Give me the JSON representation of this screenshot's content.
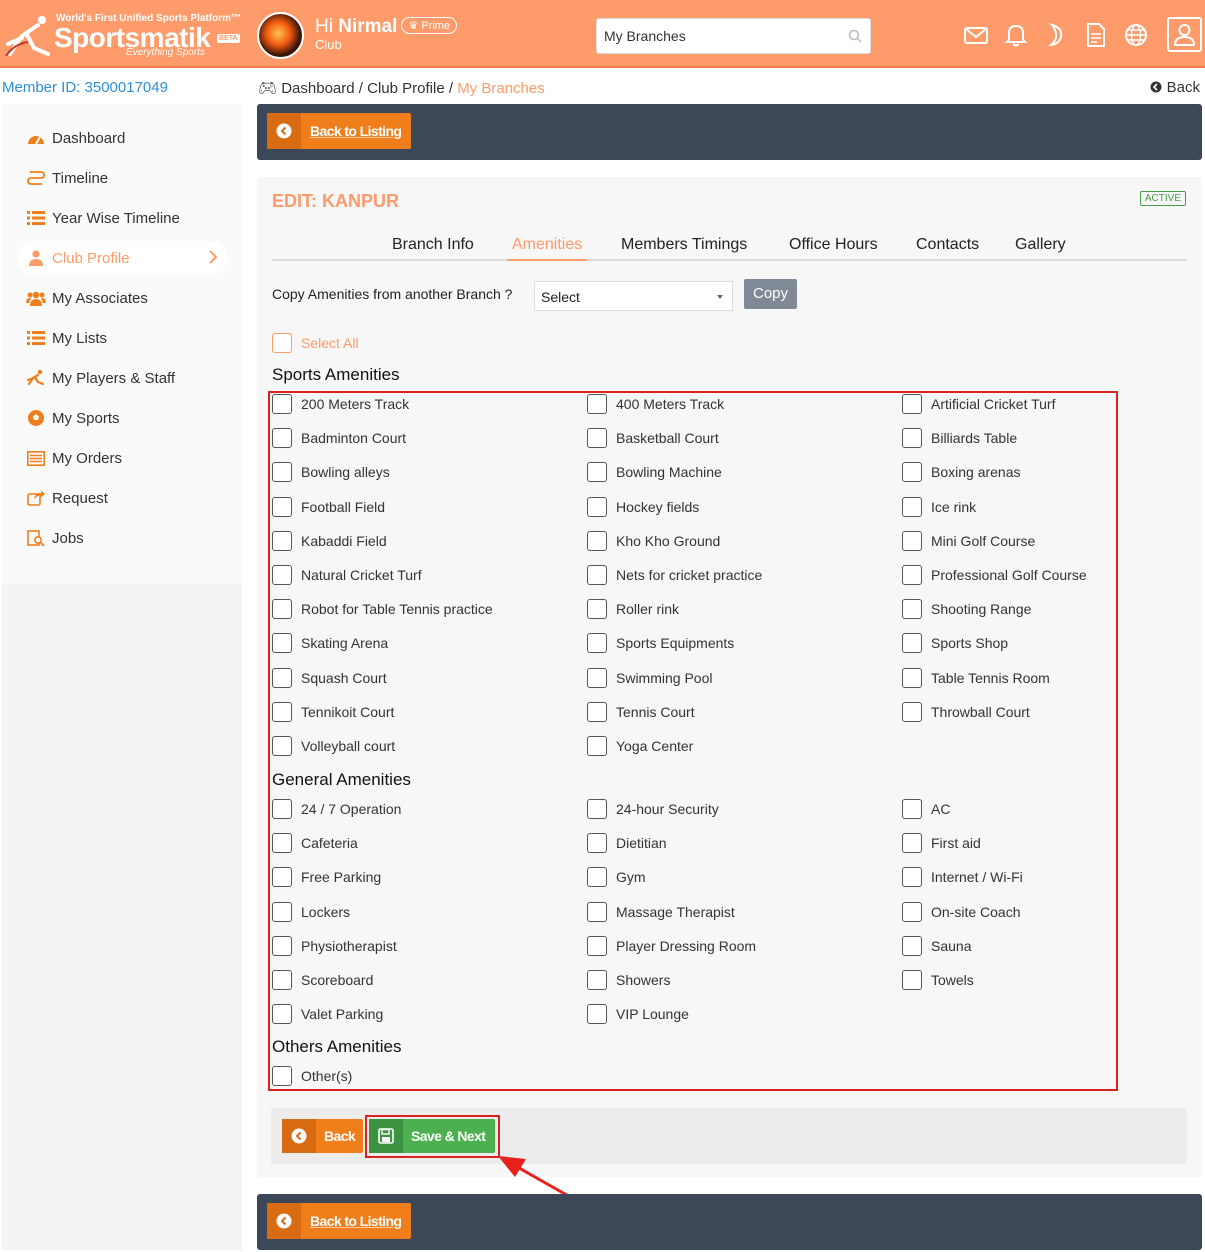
{
  "header": {
    "tagline": "World's First Unified Sports Platform™",
    "brand": "Sportsmatik",
    "beta": "BETA",
    "slogan": "Everything Sports",
    "greeting": "Hi",
    "user_name": "Nirmal",
    "prime_label": "Prime",
    "role": "Club",
    "search_value": "My Branches"
  },
  "member_id": "Member ID: 3500017049",
  "breadcrumb": {
    "dashboard": "Dashboard",
    "sep1": " / ",
    "club_profile": "Club Profile",
    "sep2": " / ",
    "current": "My Branches"
  },
  "back_top": "Back",
  "sidebar": {
    "items": [
      {
        "label": "Dashboard"
      },
      {
        "label": "Timeline"
      },
      {
        "label": "Year Wise Timeline"
      },
      {
        "label": "Club Profile"
      },
      {
        "label": "My Associates"
      },
      {
        "label": "My Lists"
      },
      {
        "label": "My Players & Staff"
      },
      {
        "label": "My Sports"
      },
      {
        "label": "My Orders"
      },
      {
        "label": "Request"
      },
      {
        "label": "Jobs"
      }
    ]
  },
  "back_to_listing": "Back to Listing",
  "edit": {
    "title": "EDIT: KANPUR",
    "status": "ACTIVE",
    "tabs": [
      {
        "label": "Branch Info"
      },
      {
        "label": "Amenities"
      },
      {
        "label": "Members Timings"
      },
      {
        "label": "Office Hours"
      },
      {
        "label": "Contacts"
      },
      {
        "label": "Gallery"
      }
    ],
    "copy_label": "Copy Amenities from another Branch ?",
    "copy_select": "Select",
    "copy_button": "Copy",
    "select_all": "Select All"
  },
  "sections": {
    "sports": {
      "title": "Sports Amenities",
      "items": [
        "200 Meters Track",
        "400 Meters Track",
        "Artificial Cricket Turf",
        "Badminton Court",
        "Basketball Court",
        "Billiards Table",
        "Bowling alleys",
        "Bowling Machine",
        "Boxing arenas",
        "Football Field",
        "Hockey fields",
        "Ice rink",
        "Kabaddi Field",
        "Kho Kho Ground",
        "Mini Golf Course",
        "Natural Cricket Turf",
        "Nets for cricket practice",
        "Professional Golf Course",
        "Robot for Table Tennis practice",
        "Roller rink",
        "Shooting Range",
        "Skating Arena",
        "Sports Equipments",
        "Sports Shop",
        "Squash Court",
        "Swimming Pool",
        "Table Tennis Room",
        "Tennikoit Court",
        "Tennis Court",
        "Throwball Court",
        "Volleyball court",
        "Yoga Center"
      ]
    },
    "general": {
      "title": "General Amenities",
      "items": [
        "24 / 7 Operation",
        "24-hour Security",
        "AC",
        "Cafeteria",
        "Dietitian",
        "First aid",
        "Free Parking",
        "Gym",
        "Internet / Wi-Fi",
        "Lockers",
        "Massage Therapist",
        "On-site Coach",
        "Physiotherapist",
        "Player Dressing Room",
        "Sauna",
        "Scoreboard",
        "Showers",
        "Towels",
        "Valet Parking",
        "VIP Lounge"
      ]
    },
    "others": {
      "title": "Others Amenities",
      "items": [
        "Other(s)"
      ]
    }
  },
  "footer": {
    "back": "Back",
    "save_next": "Save & Next"
  },
  "colors": {
    "accent": "#fd9b6b",
    "orange_button": "#f07f1b",
    "green_button": "#4caf50",
    "dark_bar": "#3c4858",
    "highlight": "#d9231d"
  }
}
